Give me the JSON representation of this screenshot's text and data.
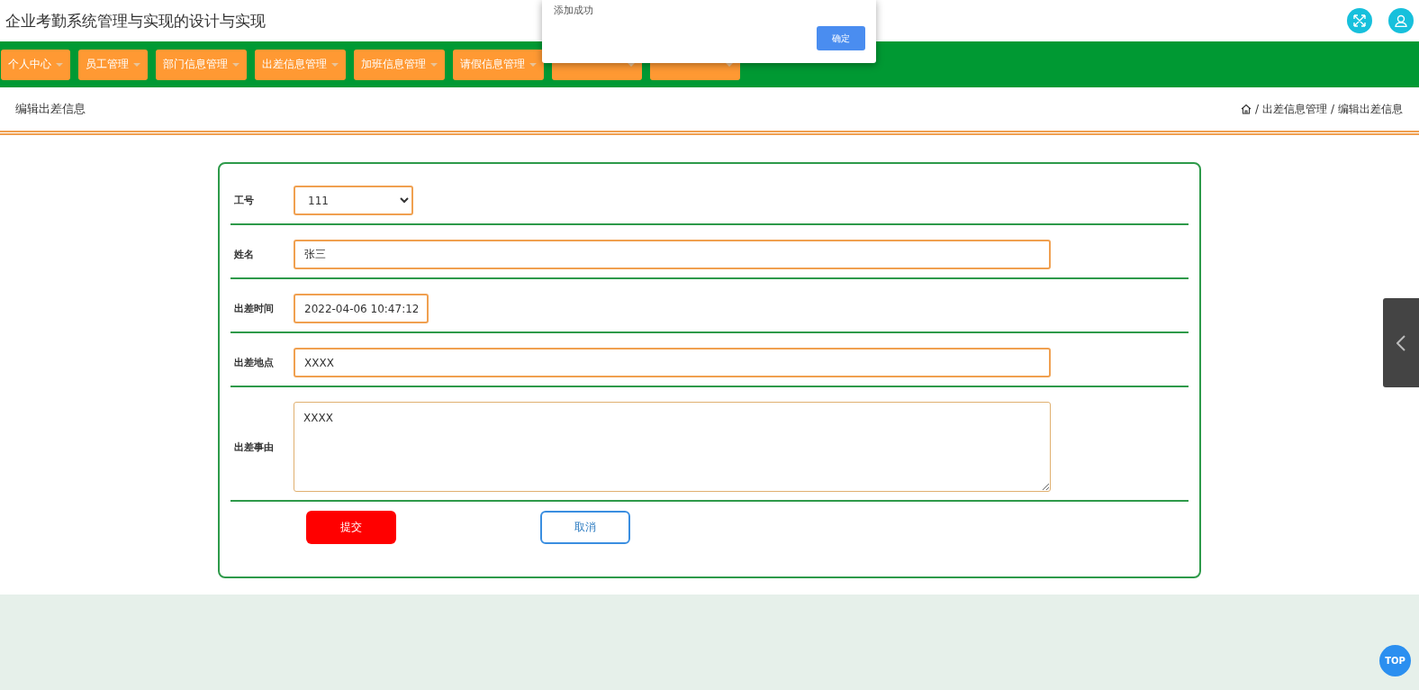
{
  "header": {
    "title": "企业考勤系统管理与实现的设计与实现"
  },
  "nav": {
    "items": [
      {
        "label": "个人中心",
        "selected": false
      },
      {
        "label": "员工管理",
        "selected": false
      },
      {
        "label": "部门信息管理",
        "selected": false
      },
      {
        "label": "出差信息管理",
        "selected": false
      },
      {
        "label": "加班信息管理",
        "selected": false
      },
      {
        "label": "请假信息管理",
        "selected": false
      },
      {
        "selected": false
      },
      {
        "selected": false
      }
    ]
  },
  "page_header": {
    "title": "编辑出差信息",
    "separator": "/",
    "breadcrumb": [
      "出差信息管理",
      "编辑出差信息"
    ]
  },
  "form": {
    "fields": [
      {
        "kind": "select",
        "label": "工号",
        "value": "111"
      },
      {
        "kind": "text",
        "label": "姓名",
        "value": "张三"
      },
      {
        "kind": "date",
        "label": "出差时间",
        "value": "2022-04-06 10:47:12"
      },
      {
        "kind": "text",
        "label": "出差地点",
        "value": "XXXX"
      },
      {
        "kind": "textarea",
        "label": "出差事由",
        "value": "XXXX"
      }
    ],
    "buttons": [
      {
        "kind": "primary",
        "label": "提交"
      },
      {
        "kind": "outline",
        "label": "取消"
      }
    ]
  },
  "dialog": {
    "message": "添加成功",
    "button": "确定"
  },
  "top_button": "TOP"
}
